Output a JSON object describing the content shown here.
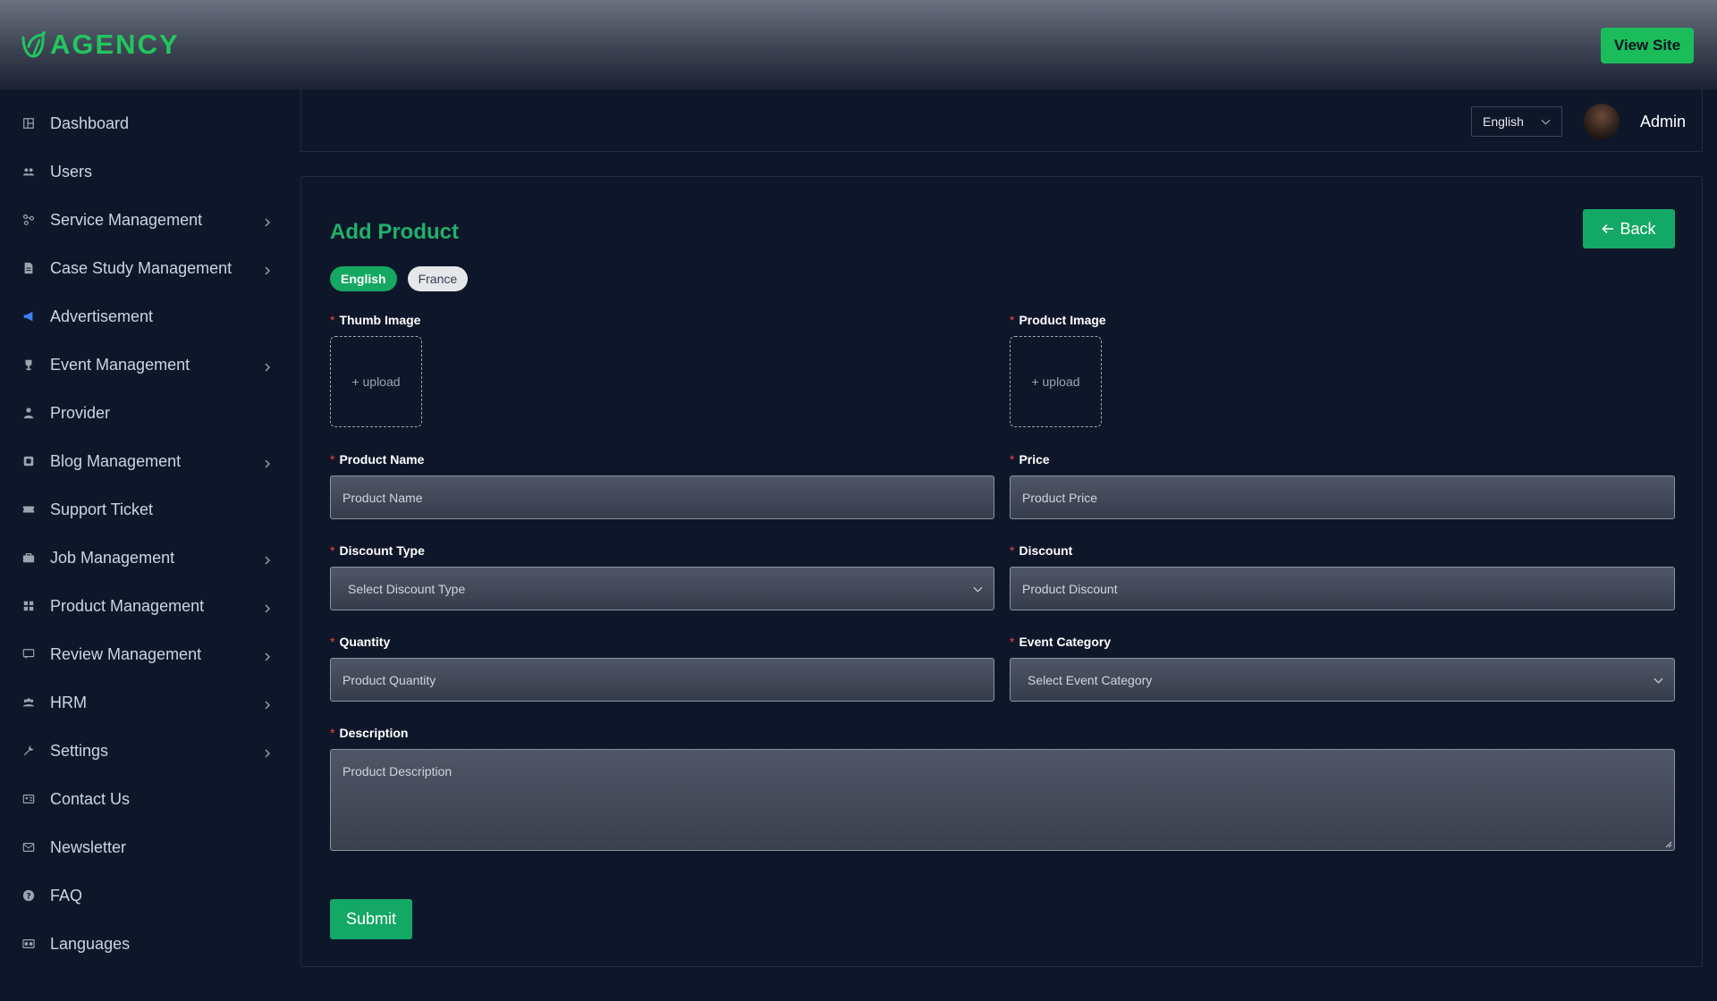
{
  "header": {
    "brand": "AGENCY",
    "view_site": "View Site"
  },
  "sidebar": {
    "items": [
      {
        "label": "Dashboard",
        "icon": "dashboard-icon",
        "has_submenu": false
      },
      {
        "label": "Users",
        "icon": "users-icon",
        "has_submenu": false
      },
      {
        "label": "Service Management",
        "icon": "service-icon",
        "has_submenu": true
      },
      {
        "label": "Case Study Management",
        "icon": "document-icon",
        "has_submenu": true
      },
      {
        "label": "Advertisement",
        "icon": "megaphone-icon",
        "has_submenu": false
      },
      {
        "label": "Event Management",
        "icon": "trophy-icon",
        "has_submenu": true
      },
      {
        "label": "Provider",
        "icon": "user-tie-icon",
        "has_submenu": false
      },
      {
        "label": "Blog Management",
        "icon": "blog-icon",
        "has_submenu": true
      },
      {
        "label": "Support Ticket",
        "icon": "ticket-icon",
        "has_submenu": false
      },
      {
        "label": "Job Management",
        "icon": "briefcase-icon",
        "has_submenu": true
      },
      {
        "label": "Product Management",
        "icon": "grid-icon",
        "has_submenu": true
      },
      {
        "label": "Review Management",
        "icon": "comment-icon",
        "has_submenu": true
      },
      {
        "label": "HRM",
        "icon": "team-icon",
        "has_submenu": true
      },
      {
        "label": "Settings",
        "icon": "wrench-icon",
        "has_submenu": true
      },
      {
        "label": "Contact Us",
        "icon": "contact-card-icon",
        "has_submenu": false
      },
      {
        "label": "Newsletter",
        "icon": "mail-icon",
        "has_submenu": false
      },
      {
        "label": "FAQ",
        "icon": "question-icon",
        "has_submenu": false
      },
      {
        "label": "Languages",
        "icon": "language-icon",
        "has_submenu": false
      }
    ]
  },
  "topbar": {
    "language": "English",
    "user": "Admin"
  },
  "form": {
    "title": "Add Product",
    "back_label": "Back",
    "tabs": [
      {
        "label": "English",
        "active": true
      },
      {
        "label": "France",
        "active": false
      }
    ],
    "thumb_image": {
      "label": "Thumb Image",
      "upload": "+ upload"
    },
    "product_image": {
      "label": "Product Image",
      "upload": "+ upload"
    },
    "product_name": {
      "label": "Product Name",
      "placeholder": "Product Name"
    },
    "price": {
      "label": "Price",
      "placeholder": "Product Price"
    },
    "discount_type": {
      "label": "Discount Type",
      "placeholder": "Select Discount Type"
    },
    "discount": {
      "label": "Discount",
      "placeholder": "Product Discount"
    },
    "quantity": {
      "label": "Quantity",
      "placeholder": "Product Quantity"
    },
    "event_category": {
      "label": "Event Category",
      "placeholder": "Select Event Category"
    },
    "description": {
      "label": "Description",
      "placeholder": "Product Description"
    },
    "required_marker": "*",
    "submit_label": "Submit"
  },
  "colors": {
    "accent": "#22c55e",
    "primary_button": "#14a866",
    "background": "#0e172a"
  }
}
